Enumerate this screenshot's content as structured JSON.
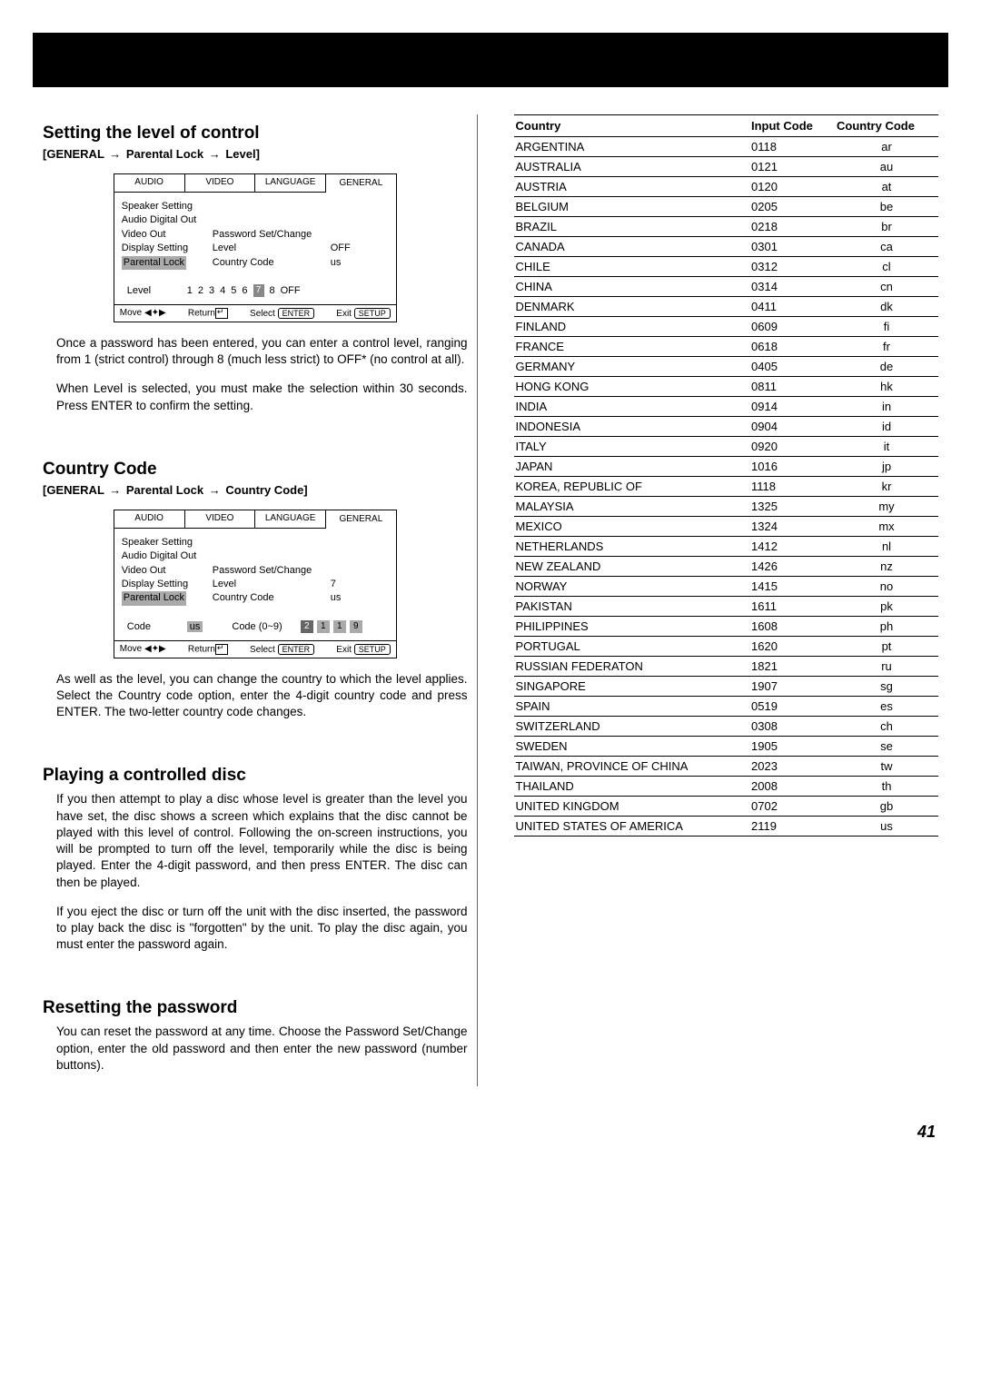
{
  "header": {
    "h_level": "Setting the level of control",
    "bc_level": "[GENERAL → Parental Lock → Level]",
    "h_cc": "Country Code",
    "bc_cc": "[GENERAL → Parental Lock → Country Code]",
    "h_play": "Playing a controlled disc",
    "h_reset": "Resetting the password"
  },
  "osd_tabs": {
    "audio": "AUDIO",
    "video": "VIDEO",
    "language": "LANGUAGE",
    "general": "GENERAL"
  },
  "osd_left": {
    "speaker": "Speaker Setting",
    "adout": "Audio Digital Out",
    "videoout": "Video Out",
    "display": "Display Setting",
    "parental": "Parental Lock"
  },
  "osd_right": {
    "pwset": "Password Set/Change",
    "level": "Level",
    "cc": "Country Code",
    "off": "OFF",
    "us": "us",
    "seven": "7"
  },
  "osd_level": {
    "lbl": "Level",
    "n1": "1",
    "n2": "2",
    "n3": "3",
    "n4": "4",
    "n5": "5",
    "n6": "6",
    "n7": "7",
    "n8": "8",
    "noff": "OFF"
  },
  "osd_cc": {
    "lbl": "Code",
    "us": "us",
    "range": "Code (0~9)",
    "d1": "2",
    "d2": "1",
    "d3": "1",
    "d4": "9"
  },
  "osd_status": {
    "move": "Move",
    "return": "Return",
    "select": "Select",
    "enter": "ENTER",
    "exit": "Exit",
    "setup": "SETUP"
  },
  "para": {
    "p1": "Once a password has been entered, you can enter a control level, ranging from 1 (strict control) through 8 (much less strict) to OFF* (no control at all).",
    "p2": "When Level is selected, you must make the selection within 30 seconds. Press ENTER to confirm the setting.",
    "p3": "As well as the level, you can change the country to which the level applies. Select the Country code option, enter the 4-digit country code and press ENTER. The two-letter country code changes.",
    "p4": "If you then attempt to play a disc whose level is greater than the level you have set, the disc shows a screen which explains that the disc cannot be played with this level of control. Following the on-screen instructions, you will be prompted to turn off the level, temporarily while the disc is being played. Enter the 4-digit password, and then press ENTER. The disc can then be played.",
    "p5": "If you eject the disc or turn off the unit with the disc inserted, the password to play back the disc is \"forgotten\" by the unit. To play the disc again, you must enter the password again.",
    "p6": "You can reset the password at any time. Choose the Password Set/Change option, enter the old password and then enter the new password (number buttons)."
  },
  "country_table": {
    "headers": {
      "country": "Country",
      "input": "Input Code",
      "code": "Country Code"
    }
  },
  "chart_data": {
    "type": "table",
    "title": "Country Codes",
    "columns": [
      "Country",
      "Input Code",
      "Country Code"
    ],
    "rows": [
      [
        "ARGENTINA",
        "0118",
        "ar"
      ],
      [
        "AUSTRALIA",
        "0121",
        "au"
      ],
      [
        "AUSTRIA",
        "0120",
        "at"
      ],
      [
        "BELGIUM",
        "0205",
        "be"
      ],
      [
        "BRAZIL",
        "0218",
        "br"
      ],
      [
        "CANADA",
        "0301",
        "ca"
      ],
      [
        "CHILE",
        "0312",
        "cl"
      ],
      [
        "CHINA",
        "0314",
        "cn"
      ],
      [
        "DENMARK",
        "0411",
        "dk"
      ],
      [
        "FINLAND",
        "0609",
        "fi"
      ],
      [
        "FRANCE",
        "0618",
        "fr"
      ],
      [
        "GERMANY",
        "0405",
        "de"
      ],
      [
        "HONG KONG",
        "0811",
        "hk"
      ],
      [
        "INDIA",
        "0914",
        "in"
      ],
      [
        "INDONESIA",
        "0904",
        "id"
      ],
      [
        "ITALY",
        "0920",
        "it"
      ],
      [
        "JAPAN",
        "1016",
        "jp"
      ],
      [
        "KOREA, REPUBLIC OF",
        "1118",
        "kr"
      ],
      [
        "MALAYSIA",
        "1325",
        "my"
      ],
      [
        "MEXICO",
        "1324",
        "mx"
      ],
      [
        "NETHERLANDS",
        "1412",
        "nl"
      ],
      [
        "NEW ZEALAND",
        "1426",
        "nz"
      ],
      [
        "NORWAY",
        "1415",
        "no"
      ],
      [
        "PAKISTAN",
        "1611",
        "pk"
      ],
      [
        "PHILIPPINES",
        "1608",
        "ph"
      ],
      [
        "PORTUGAL",
        "1620",
        "pt"
      ],
      [
        "RUSSIAN FEDERATON",
        "1821",
        "ru"
      ],
      [
        "SINGAPORE",
        "1907",
        "sg"
      ],
      [
        "SPAIN",
        "0519",
        "es"
      ],
      [
        "SWITZERLAND",
        "0308",
        "ch"
      ],
      [
        "SWEDEN",
        "1905",
        "se"
      ],
      [
        "TAIWAN, PROVINCE OF CHINA",
        "2023",
        "tw"
      ],
      [
        "THAILAND",
        "2008",
        "th"
      ],
      [
        "UNITED KINGDOM",
        "0702",
        "gb"
      ],
      [
        "UNITED STATES OF AMERICA",
        "2119",
        "us"
      ]
    ]
  },
  "page_num": "41"
}
